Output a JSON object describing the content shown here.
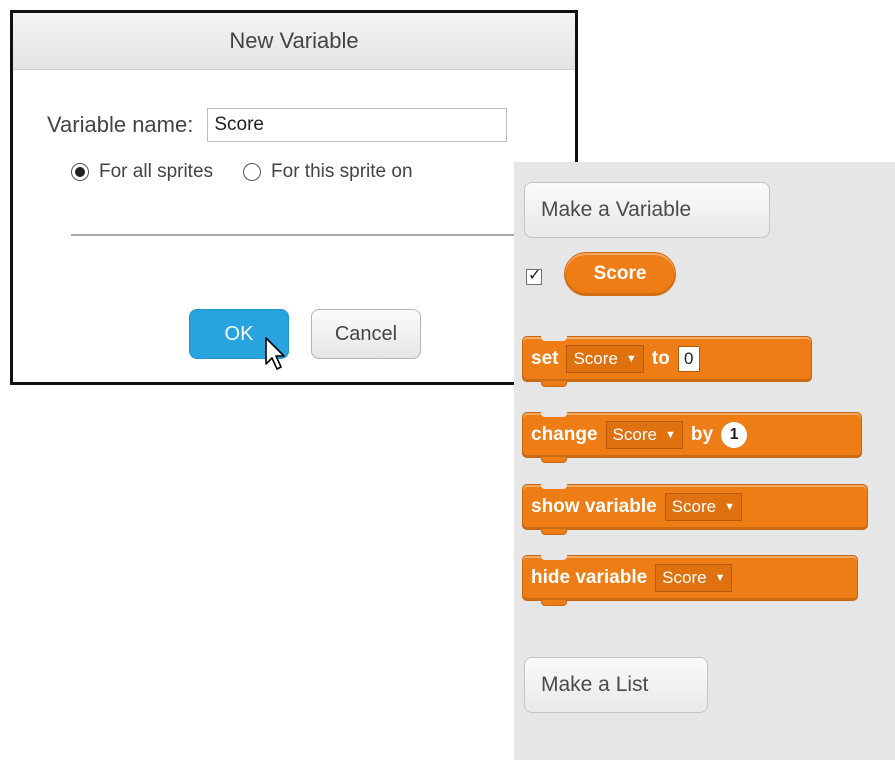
{
  "dialog": {
    "title": "New Variable",
    "name_label": "Variable name:",
    "name_value": "Score",
    "radio_all": "For all sprites",
    "radio_this": "For this sprite on",
    "ok": "OK",
    "cancel": "Cancel"
  },
  "palette": {
    "make_variable": "Make a Variable",
    "variable_reporter": "Score",
    "variable_checked": true,
    "blocks": {
      "set": {
        "kw1": "set",
        "var": "Score",
        "kw2": "to",
        "value": "0"
      },
      "change": {
        "kw1": "change",
        "var": "Score",
        "kw2": "by",
        "value": "1"
      },
      "show": {
        "kw1": "show variable",
        "var": "Score"
      },
      "hide": {
        "kw1": "hide variable",
        "var": "Score"
      }
    },
    "make_list": "Make a List"
  },
  "colors": {
    "block_orange": "#ee7d16",
    "ok_blue": "#27a4de",
    "palette_bg": "#e6e6e6"
  }
}
